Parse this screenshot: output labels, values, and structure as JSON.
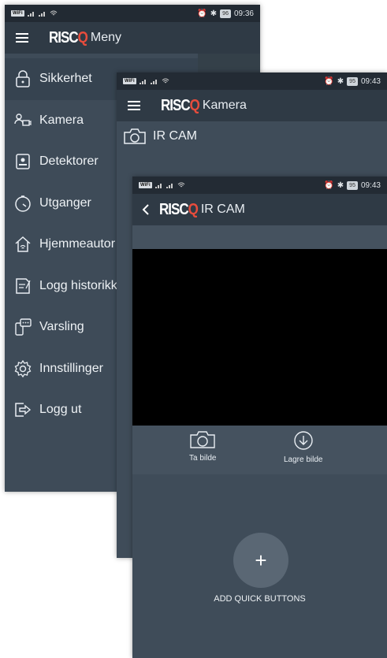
{
  "brand": {
    "logo_main": "RISC",
    "logo_accent": "Q",
    "accent_color": "#e74c3c"
  },
  "screen_menu": {
    "status": {
      "time": "09:36",
      "battery": "96"
    },
    "title": "Meny",
    "items": [
      {
        "label": "Sikkerhet",
        "icon": "lock-icon"
      },
      {
        "label": "Kamera",
        "icon": "camera-people-icon"
      },
      {
        "label": "Detektorer",
        "icon": "detector-icon"
      },
      {
        "label": "Utganger",
        "icon": "timer-icon"
      },
      {
        "label": "Hjemmeautor",
        "icon": "home-automation-icon"
      },
      {
        "label": "Logg historikk",
        "icon": "log-icon"
      },
      {
        "label": "Varsling",
        "icon": "notification-icon"
      },
      {
        "label": "Innstillinger",
        "icon": "gear-icon"
      },
      {
        "label": "Logg ut",
        "icon": "logout-icon"
      }
    ]
  },
  "screen_kamera": {
    "status": {
      "time": "09:43",
      "battery": "95"
    },
    "title": "Kamera",
    "camera_name": "IR CAM"
  },
  "screen_ircam": {
    "status": {
      "time": "09:43",
      "battery": "95"
    },
    "title": "IR CAM",
    "take_photo_label": "Ta bilde",
    "save_photo_label": "Lagre bilde",
    "add_quick_buttons_label": "ADD QUICK BUTTONS",
    "fab_symbol": "+"
  }
}
